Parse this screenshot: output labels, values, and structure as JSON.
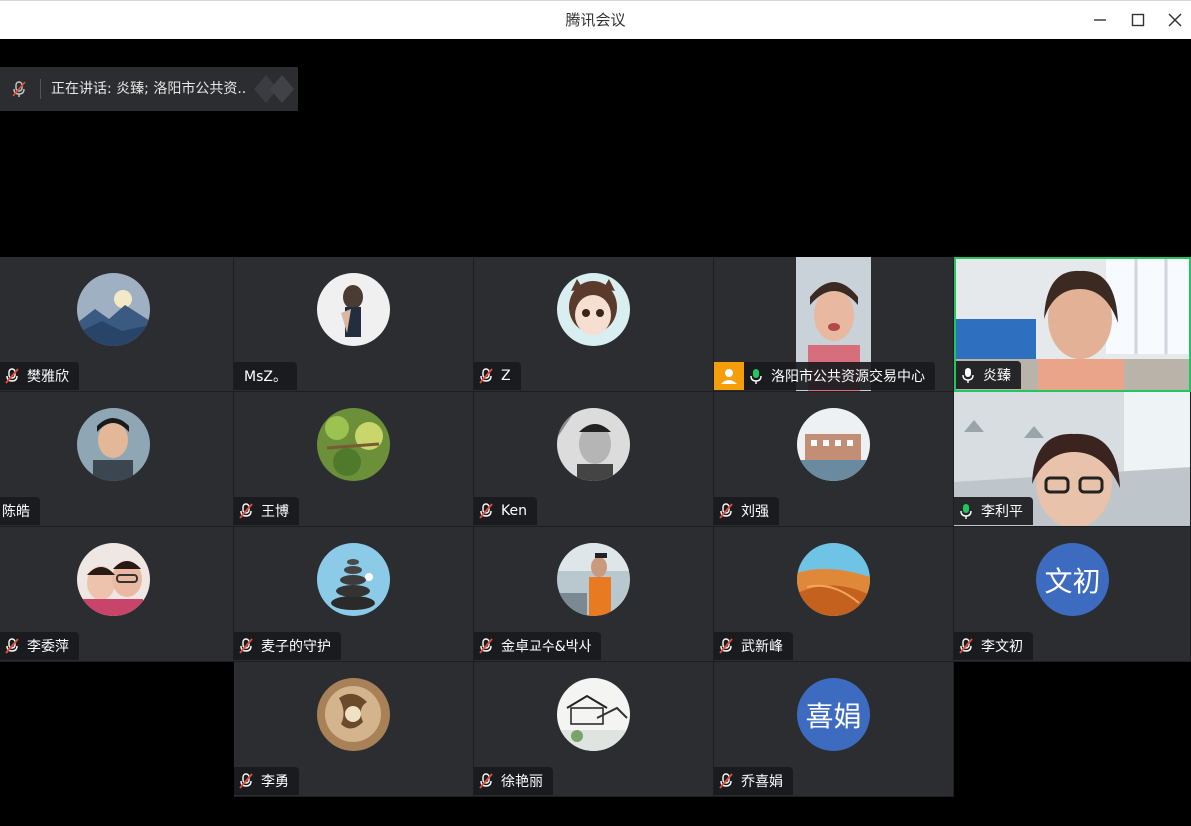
{
  "window": {
    "title": "腾讯会议"
  },
  "speaking": {
    "text": "正在讲话:  炎臻; 洛阳市公共资.."
  },
  "participants": [
    {
      "name": "樊雅欣",
      "muted": true,
      "avatar": "landscape-avatar"
    },
    {
      "name": "MsZ。",
      "muted": null,
      "avatar": "photo-avatar"
    },
    {
      "name": "Z",
      "muted": true,
      "avatar": "cartoon-avatar"
    },
    {
      "name": "洛阳市公共资源交易中心",
      "muted": false,
      "avatar": "video"
    },
    {
      "name": "炎臻",
      "muted": false,
      "avatar": "video"
    },
    {
      "name": "陈皓",
      "muted": null,
      "avatar": "photo-avatar"
    },
    {
      "name": "王博",
      "muted": true,
      "avatar": "plant-avatar"
    },
    {
      "name": "Ken",
      "muted": true,
      "avatar": "photo-avatar"
    },
    {
      "name": "刘强",
      "muted": true,
      "avatar": "building-avatar"
    },
    {
      "name": "李利平",
      "muted": false,
      "avatar": "video"
    },
    {
      "name": "李委萍",
      "muted": true,
      "avatar": "photo-avatar"
    },
    {
      "name": "麦子的守护",
      "muted": true,
      "avatar": "stones-avatar"
    },
    {
      "name": "金卓교수&박사",
      "muted": true,
      "avatar": "photo-avatar"
    },
    {
      "name": "武新峰",
      "muted": true,
      "avatar": "desert-avatar"
    },
    {
      "name": "李文初",
      "muted": true,
      "avatar_text": "文初"
    },
    {
      "name": "李勇",
      "muted": true,
      "avatar": "art-avatar"
    },
    {
      "name": "徐艳丽",
      "muted": true,
      "avatar": "sketch-avatar"
    },
    {
      "name": "乔喜娟",
      "muted": true,
      "avatar_text": "喜娟"
    }
  ],
  "colors": {
    "tile_bg": "#2b2d31",
    "active_speaker_border": "#22c55e",
    "muted_red": "#e74c3c",
    "mic_green": "#22c55e",
    "text_avatar_bg": "#3d6bc0"
  }
}
